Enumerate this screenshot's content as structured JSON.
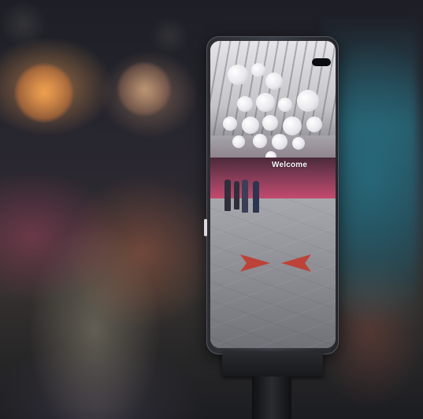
{
  "scene": {
    "subject": "smartphone-on-stand",
    "screen_text": "Welcome",
    "colors": {
      "background_warm": "#e89a50",
      "background_teal": "#2a8296",
      "phone_body": "#2f3138",
      "hall_wall": "#c44a6e",
      "marker_red": "#c23a2e"
    }
  }
}
